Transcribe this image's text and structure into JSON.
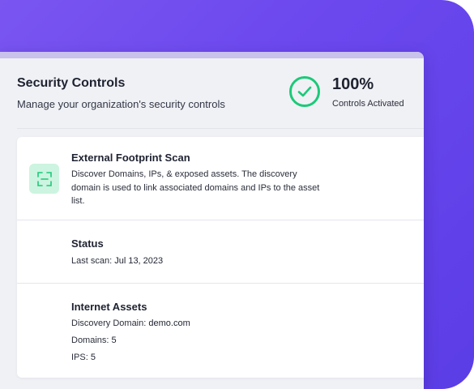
{
  "header": {
    "title": "Security Controls",
    "subtitle": "Manage your organization's security controls",
    "stat_value": "100%",
    "stat_label": "Controls Activated",
    "badge_icon": "check-circle-icon",
    "badge_color": "#1cc979"
  },
  "scan": {
    "icon": "scan-frame-icon",
    "title": "External Footprint Scan",
    "description": "Discover Domains, IPs, & exposed assets. The discovery domain is used to link associated domains and IPs to the asset list."
  },
  "status": {
    "title": "Status",
    "last_scan_label": "Last scan:",
    "last_scan_value": "Jul 13, 2023"
  },
  "internet_assets": {
    "title": "Internet Assets",
    "discovery_domain_label": "Discovery Domain:",
    "discovery_domain_value": "demo.com",
    "domains_label": "Domains:",
    "domains_value": "5",
    "ips_label": "IPS:",
    "ips_value": "5"
  },
  "colors": {
    "accent_purple": "#6b48ee",
    "success_green": "#1cc979",
    "icon_bg_green": "#cdf4e0"
  }
}
